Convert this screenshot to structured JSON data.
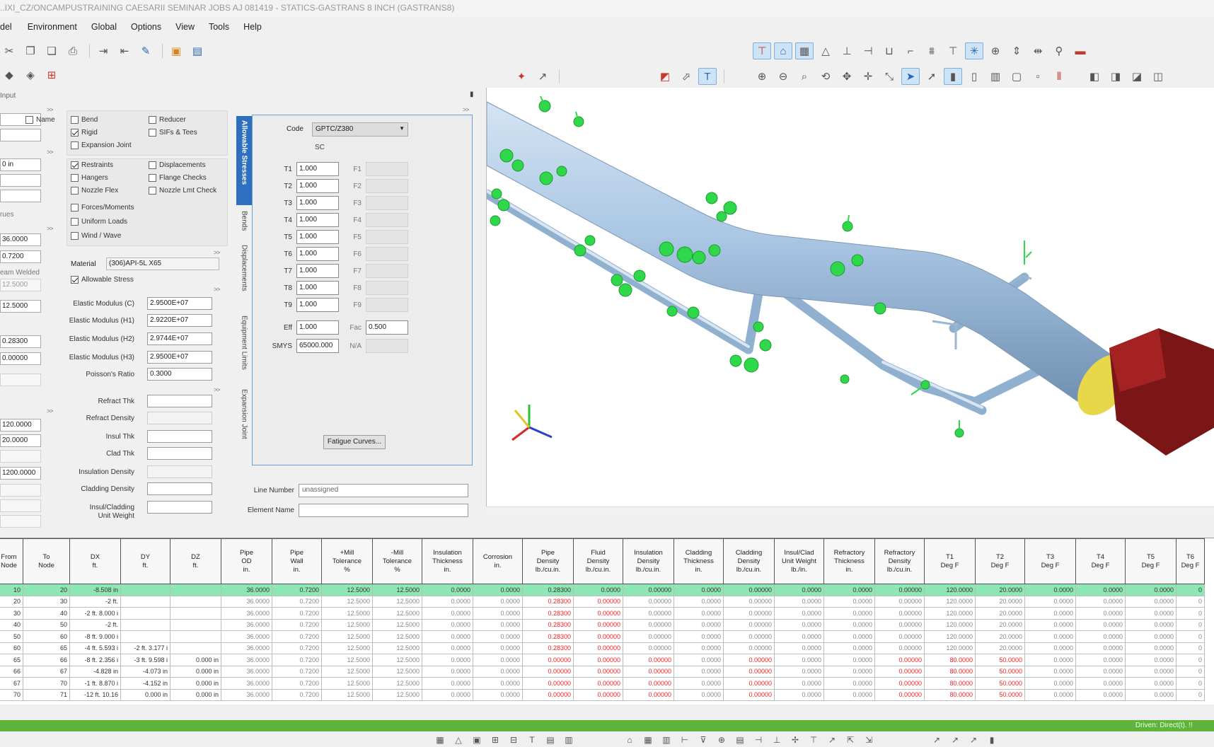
{
  "window": {
    "title": "..IXI_CZ/ONCAMPUSTRAINING CAESARII SEMINAR JOBS AJ 081419 - STATICS-GASTRANS 8 INCH (GASTRANS8)"
  },
  "menu": [
    "del",
    "Environment",
    "Global",
    "Options",
    "View",
    "Tools",
    "Help"
  ],
  "section_label": "Input",
  "left_fields": {
    "name_label": "Name",
    "field_1": "0 in",
    "rows_label": "rues",
    "field_od": "36.0000",
    "field_wall": "0.7200",
    "seam_label": "eam Welded",
    "field_seam": "12.5000",
    "field_mill": "12.5000",
    "field_den": "0.28300",
    "field_corr": "0.00000",
    "field_t1": "120.0000",
    "field_t2": "20.0000",
    "field_p": "1200.0000"
  },
  "checkboxes": {
    "bend": "Bend",
    "reducer": "Reducer",
    "rigid": "Rigid",
    "sifs": "SIFs & Tees",
    "expansion": "Expansion Joint",
    "restraints": "Restraints",
    "displacements": "Displacements",
    "hangers": "Hangers",
    "flange": "Flange Checks",
    "nozzle_flex": "Nozzle Flex",
    "nozzle_lim": "Nozzle Lmt Check",
    "forces": "Forces/Moments",
    "uniform": "Uniform Loads",
    "wind": "Wind / Wave",
    "allowable": "Allowable Stress"
  },
  "material": {
    "label": "Material",
    "value": "(306)API-5L X65"
  },
  "properties": [
    {
      "label": "Elastic Modulus (C)",
      "value": "2.9500E+07"
    },
    {
      "label": "Elastic Modulus (H1)",
      "value": "2.9220E+07"
    },
    {
      "label": "Elastic Modulus (H2)",
      "value": "2.9744E+07"
    },
    {
      "label": "Elastic Modulus (H3)",
      "value": "2.9500E+07"
    },
    {
      "label": "Poisson's Ratio",
      "value": "0.3000"
    }
  ],
  "insulation": {
    "refract_thk": "Refract Thk",
    "refract_den": "Refract Density",
    "insul_thk": "Insul Thk",
    "clad_thk": "Clad Thk",
    "insul_den": "Insulation Density",
    "clad_den": "Cladding Density",
    "insul_clad": "Insul/Cladding",
    "unit_weight": "Unit Weight"
  },
  "vertical_tabs": [
    "Allowable Stresses",
    "Bends",
    "Displacements",
    "Equipment Limits",
    "Expansion Joint"
  ],
  "stress": {
    "code_label": "Code",
    "code_value": "GPTC/Z380",
    "sc_label": "SC",
    "t_rows": [
      {
        "t": "T1",
        "v": "1.000",
        "f": "F1"
      },
      {
        "t": "T2",
        "v": "1.000",
        "f": "F2"
      },
      {
        "t": "T3",
        "v": "1.000",
        "f": "F3"
      },
      {
        "t": "T4",
        "v": "1.000",
        "f": "F4"
      },
      {
        "t": "T5",
        "v": "1.000",
        "f": "F5"
      },
      {
        "t": "T6",
        "v": "1.000",
        "f": "F6"
      },
      {
        "t": "T7",
        "v": "1.000",
        "f": "F7"
      },
      {
        "t": "T8",
        "v": "1.000",
        "f": "F8"
      },
      {
        "t": "T9",
        "v": "1.000",
        "f": "F9"
      }
    ],
    "eff_label": "Eff",
    "eff_value": "1.000",
    "fac_label": "Fac",
    "fac_value": "0.500",
    "smys_label": "SMYS",
    "smys_value": "65000.000",
    "na_label": "N/A",
    "fatigue_button": "Fatigue Curves..."
  },
  "line_number": {
    "label": "Line Number",
    "value": "unassigned"
  },
  "element_name": {
    "label": "Element Name",
    "value": ""
  },
  "grid": {
    "headers": [
      "From\nNode",
      "To\nNode",
      "DX\nft.",
      "DY\nft.",
      "DZ\nft.",
      "Pipe\nOD\nin.",
      "Pipe\nWall\nin.",
      "+Mill\nTolerance\n%",
      "-Mill\nTolerance\n%",
      "Insulation\nThickness\nin.",
      "Corrosion\nin.",
      "Pipe\nDensity\nlb./cu.in.",
      "Fluid\nDensity\nlb./cu.in.",
      "Insulation\nDensity\nlb./cu.in.",
      "Cladding\nThickness\nin.",
      "Cladding\nDensity\nlb./cu.in.",
      "Insul/Clad\nUnit Weight\nlb./in.",
      "Refractory\nThickness\nin.",
      "Refractory\nDensity\nlb./cu.in.",
      "T1\nDeg F",
      "T2\nDeg F",
      "T3\nDeg F",
      "T4\nDeg F",
      "T5\nDeg F",
      "T6\nDeg F"
    ],
    "rows": [
      [
        "10",
        "20",
        "-8.508 in",
        "",
        "",
        "36.0000",
        "0.7200",
        "12.5000",
        "12.5000",
        "0.0000",
        "0.0000",
        "0.28300",
        "0.0000",
        "0.00000",
        "0.0000",
        "0.00000",
        "0.0000",
        "0.0000",
        "0.00000",
        "120.0000",
        "20.0000",
        "0.0000",
        "0.0000",
        "0.0000",
        "0"
      ],
      [
        "20",
        "30",
        "-2 ft.",
        "",
        "",
        "36.0000",
        "0.7200",
        "12.5000",
        "12.5000",
        "0.0000",
        "0.0000",
        "0.28300",
        "0.00000",
        "0.00000",
        "0.0000",
        "0.00000",
        "0.0000",
        "0.0000",
        "0.00000",
        "120.0000",
        "20.0000",
        "0.0000",
        "0.0000",
        "0.0000",
        "0"
      ],
      [
        "30",
        "40",
        "-2 ft. 8.000 i",
        "",
        "",
        "36.0000",
        "0.7200",
        "12.5000",
        "12.5000",
        "0.0000",
        "0.0000",
        "0.28300",
        "0.00000",
        "0.00000",
        "0.0000",
        "0.00000",
        "0.0000",
        "0.0000",
        "0.00000",
        "120.0000",
        "20.0000",
        "0.0000",
        "0.0000",
        "0.0000",
        "0"
      ],
      [
        "40",
        "50",
        "-2 ft.",
        "",
        "",
        "36.0000",
        "0.7200",
        "12.5000",
        "12.5000",
        "0.0000",
        "0.0000",
        "0.28300",
        "0.00000",
        "0.00000",
        "0.0000",
        "0.00000",
        "0.0000",
        "0.0000",
        "0.00000",
        "120.0000",
        "20.0000",
        "0.0000",
        "0.0000",
        "0.0000",
        "0"
      ],
      [
        "50",
        "60",
        "-8 ft. 9.000 i",
        "",
        "",
        "36.0000",
        "0.7200",
        "12.5000",
        "12.5000",
        "0.0000",
        "0.0000",
        "0.28300",
        "0.00000",
        "0.00000",
        "0.0000",
        "0.00000",
        "0.0000",
        "0.0000",
        "0.00000",
        "120.0000",
        "20.0000",
        "0.0000",
        "0.0000",
        "0.0000",
        "0"
      ],
      [
        "60",
        "65",
        "-4 ft. 5.593 i",
        "-2 ft. 3.177 i",
        "",
        "36.0000",
        "0.7200",
        "12.5000",
        "12.5000",
        "0.0000",
        "0.0000",
        "0.28300",
        "0.00000",
        "0.00000",
        "0.0000",
        "0.00000",
        "0.0000",
        "0.0000",
        "0.00000",
        "120.0000",
        "20.0000",
        "0.0000",
        "0.0000",
        "0.0000",
        "0"
      ],
      [
        "65",
        "66",
        "-8 ft. 2.356 i",
        "-3 ft. 9.598 i",
        "0.000 in",
        "36.0000",
        "0.7200",
        "12.5000",
        "12.5000",
        "0.0000",
        "0.0000",
        "0.00000",
        "0.00000",
        "0.00000",
        "0.0000",
        "0.00000",
        "0.0000",
        "0.0000",
        "0.00000",
        "80.0000",
        "50.0000",
        "0.0000",
        "0.0000",
        "0.0000",
        "0"
      ],
      [
        "66",
        "67",
        "-4.828 in",
        "-4.073 in",
        "0.000 in",
        "36.0000",
        "0.7200",
        "12.5000",
        "12.5000",
        "0.0000",
        "0.0000",
        "0.00000",
        "0.00000",
        "0.00000",
        "0.0000",
        "0.00000",
        "0.0000",
        "0.0000",
        "0.00000",
        "80.0000",
        "50.0000",
        "0.0000",
        "0.0000",
        "0.0000",
        "0"
      ],
      [
        "67",
        "70",
        "-1 ft. 8.870 i",
        "-4.152 in",
        "0.000 in",
        "36.0000",
        "0.7200",
        "12.5000",
        "12.5000",
        "0.0000",
        "0.0000",
        "0.00000",
        "0.00000",
        "0.00000",
        "0.0000",
        "0.00000",
        "0.0000",
        "0.0000",
        "0.00000",
        "80.0000",
        "50.0000",
        "0.0000",
        "0.0000",
        "0.0000",
        "0"
      ],
      [
        "70",
        "71",
        "-12 ft. 10.16",
        "0.000 in",
        "0.000 in",
        "36.0000",
        "0.7200",
        "12.5000",
        "12.5000",
        "0.0000",
        "0.0000",
        "0.00000",
        "0.00000",
        "0.00000",
        "0.0000",
        "0.00000",
        "0.0000",
        "0.0000",
        "0.00000",
        "80.0000",
        "50.0000",
        "0.0000",
        "0.0000",
        "0.0000",
        "0"
      ]
    ]
  },
  "status": {
    "text": "Driven: Direct(t). !!"
  },
  "colors": {
    "selection_row": "#8de6b4",
    "status_bar": "#5fb33a",
    "accent": "#2f6fc0",
    "pipe": "#a9c6e3",
    "support": "#2fd84a",
    "end_block": "#7a1616"
  }
}
